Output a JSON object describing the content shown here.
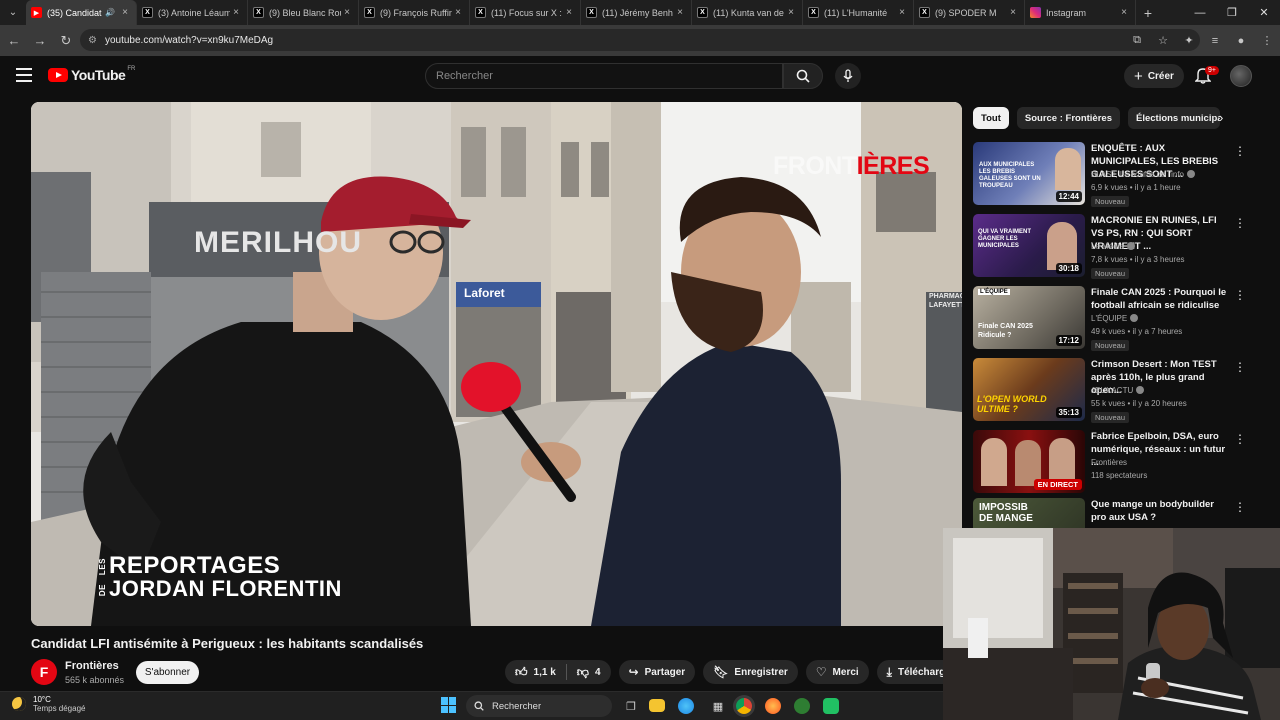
{
  "browser": {
    "tabs": [
      {
        "label": "(35) Candidat",
        "icon": "youtube-icon",
        "active": true
      },
      {
        "label": "(3) Antoine Léaum",
        "icon": "x-icon"
      },
      {
        "label": "(9) Bleu Blanc Rou",
        "icon": "x-icon"
      },
      {
        "label": "(9) François Ruffin",
        "icon": "x-icon"
      },
      {
        "label": "(11) Focus sur X :",
        "icon": "x-icon"
      },
      {
        "label": "(11) Jérémy Benh",
        "icon": "x-icon"
      },
      {
        "label": "(11) Kunta van de",
        "icon": "x-icon"
      },
      {
        "label": "(11) L'Humanité",
        "icon": "x-icon"
      },
      {
        "label": "(9) SPODER M",
        "icon": "x-icon"
      },
      {
        "label": "Instagram",
        "icon": "instagram-icon"
      }
    ],
    "url": "youtube.com/watch?v=xn9ku7MeDAg"
  },
  "masthead": {
    "logo_text": "YouTube",
    "country": "FR",
    "search_placeholder": "Rechercher",
    "create_label": "Créer",
    "notif_count": "9+"
  },
  "video": {
    "watermark_a": "FRONT",
    "watermark_b": "IÈRES",
    "brand_small": "LES",
    "brand_line1": "REPORTAGES",
    "brand_small2": "DE",
    "brand_line2": "JORDAN FLORENTIN",
    "storefront": "MERILHOU",
    "shop_sign": "Laforet",
    "pharmacy": "PHARMACIE LAFAYETTE",
    "title": "Candidat LFI antisémite à Perigueux : les habitants scandalisés",
    "channel": "Frontières",
    "channel_initial": "F",
    "subs": "565 k abonnés",
    "subscribe": "S'abonner",
    "likes": "1,1 k",
    "dislikes": "4",
    "share": "Partager",
    "save": "Enregistrer",
    "thanks": "Merci",
    "download": "Télécharger"
  },
  "chips": [
    "Tout",
    "Source : Frontières",
    "Élections municipales"
  ],
  "recommendations": [
    {
      "title": "ENQUÊTE : AUX MUNICIPALES, LES BREBIS GALEUSES SONT ...",
      "channel": "BLAST, Le souffle de l'info",
      "verified": true,
      "meta": "6,9 k vues • il y a 1 heure",
      "badge": "Nouveau",
      "duration": "12:44",
      "thumb_text": "AUX MUNICIPALES LES BREBIS GALEUSES SONT UN TROUPEAU"
    },
    {
      "title": "MACRONIE EN RUINES, LFI VS PS, RN : QUI SORT VRAIMENT ...",
      "channel": "Le Média",
      "verified": true,
      "meta": "7,8 k vues • il y a 3 heures",
      "badge": "Nouveau",
      "duration": "30:18",
      "thumb_text": "QUI VA VRAIMENT GAGNER LES MUNICIPALES"
    },
    {
      "title": "Finale CAN 2025 : Pourquoi le football africain se ridiculise",
      "channel": "L'ÉQUIPE",
      "verified": true,
      "meta": "49 k vues • il y a 7 heures",
      "badge": "Nouveau",
      "duration": "17:12",
      "thumb_text": "Finale CAN 2025 Ridicule ?"
    },
    {
      "title": "Crimson Desert : Mon TEST après 110h, le plus grand open...",
      "channel": "JEUXACTU",
      "verified": true,
      "meta": "55 k vues • il y a 20 heures",
      "badge": "Nouveau",
      "duration": "35:13",
      "thumb_text": "L'OPEN WORLD ULTIME ?"
    },
    {
      "title": "Fabrice Epelboin, DSA, euro numérique, réseaux : un futur ...",
      "channel": "Frontières",
      "verified": false,
      "meta": "118 spectateurs",
      "badge": "",
      "live": "EN DIRECT",
      "thumb_text": ""
    },
    {
      "title": "Que mange un bodybuilder pro aux USA ?",
      "channel": "",
      "verified": false,
      "meta": "",
      "badge": "",
      "duration": "",
      "thumb_text": "IMPOSSIB DE MANGE"
    }
  ],
  "taskbar": {
    "temp": "10°C",
    "weather": "Temps dégagé",
    "search": "Rechercher"
  }
}
